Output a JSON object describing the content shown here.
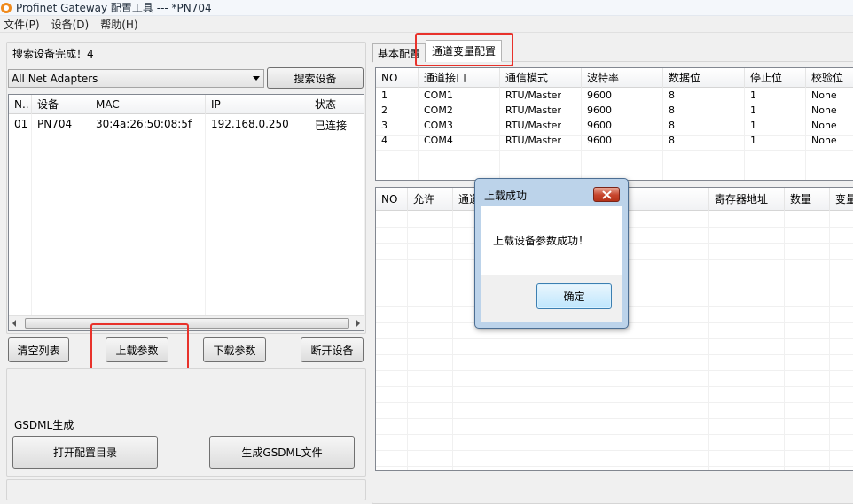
{
  "window": {
    "title": "Profinet Gateway 配置工具 --- *PN704"
  },
  "menu": [
    "文件(P)",
    "设备(D)",
    "帮助(H)"
  ],
  "left": {
    "status_text": "搜索设备完成！4",
    "adapter_select": "All Net Adapters",
    "search_button": "搜索设备",
    "device_table": {
      "columns": [
        "N..",
        "设备",
        "MAC",
        "IP",
        "状态"
      ],
      "rows": [
        {
          "no": "01",
          "device": "PN704",
          "mac": "30:4a:26:50:08:5f",
          "ip": "192.168.0.250",
          "status": "已连接"
        }
      ]
    },
    "buttons": {
      "clear": "清空列表",
      "upload": "上载参数",
      "download": "下载参数",
      "disconnect": "断开设备"
    },
    "gsdml": {
      "title": "GSDML生成",
      "open_dir": "打开配置目录",
      "generate": "生成GSDML文件"
    }
  },
  "right": {
    "tabs": [
      "基本配置",
      "通道变量配置"
    ],
    "channel_table": {
      "columns": [
        "NO",
        "通道接口",
        "通信模式",
        "波特率",
        "数据位",
        "停止位",
        "校验位"
      ],
      "rows": [
        {
          "no": "1",
          "port": "COM1",
          "mode": "RTU/Master",
          "baud": "9600",
          "data_bits": "8",
          "stop_bits": "1",
          "parity": "None"
        },
        {
          "no": "2",
          "port": "COM2",
          "mode": "RTU/Master",
          "baud": "9600",
          "data_bits": "8",
          "stop_bits": "1",
          "parity": "None"
        },
        {
          "no": "3",
          "port": "COM3",
          "mode": "RTU/Master",
          "baud": "9600",
          "data_bits": "8",
          "stop_bits": "1",
          "parity": "None"
        },
        {
          "no": "4",
          "port": "COM4",
          "mode": "RTU/Master",
          "baud": "9600",
          "data_bits": "8",
          "stop_bits": "1",
          "parity": "None"
        }
      ]
    },
    "var_table": {
      "columns": [
        "NO",
        "允许",
        "通道",
        "寄存器地址",
        "数量",
        "变量"
      ]
    }
  },
  "dialog": {
    "title": "上载成功",
    "message": "上载设备参数成功！",
    "ok": "确定"
  },
  "colors": {
    "highlight": "#e8322b",
    "dialog_frame": "#bcd3ea",
    "close_button": "#c6442c"
  }
}
